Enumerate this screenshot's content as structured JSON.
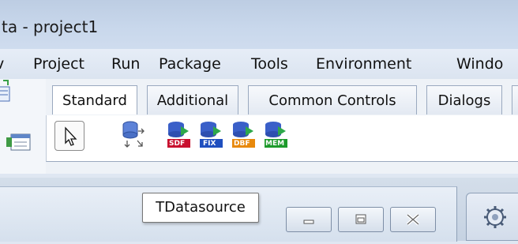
{
  "window": {
    "title": "ta - project1"
  },
  "menu": {
    "items": [
      "Project",
      "Run",
      "Package",
      "Tools",
      "Environment",
      "Windo"
    ]
  },
  "palette": {
    "tabs": [
      "Standard",
      "Additional",
      "Common Controls",
      "Dialogs"
    ],
    "components": [
      {
        "name": "datasource-arrows-icon",
        "label": ""
      },
      {
        "name": "sdf-dataset-icon",
        "label": "SDF",
        "color": "#c8102e"
      },
      {
        "name": "fix-dataset-icon",
        "label": "FIX",
        "color": "#1f4fbf"
      },
      {
        "name": "dbf-dataset-icon",
        "label": "DBF",
        "color": "#e8890c"
      },
      {
        "name": "mem-dataset-icon",
        "label": "MEM",
        "color": "#1d9a2b"
      }
    ]
  },
  "tooltip": {
    "text": "TDatasource"
  },
  "colors": {
    "db_blue": "#3a5fc8",
    "db_green": "#2ea84a"
  }
}
